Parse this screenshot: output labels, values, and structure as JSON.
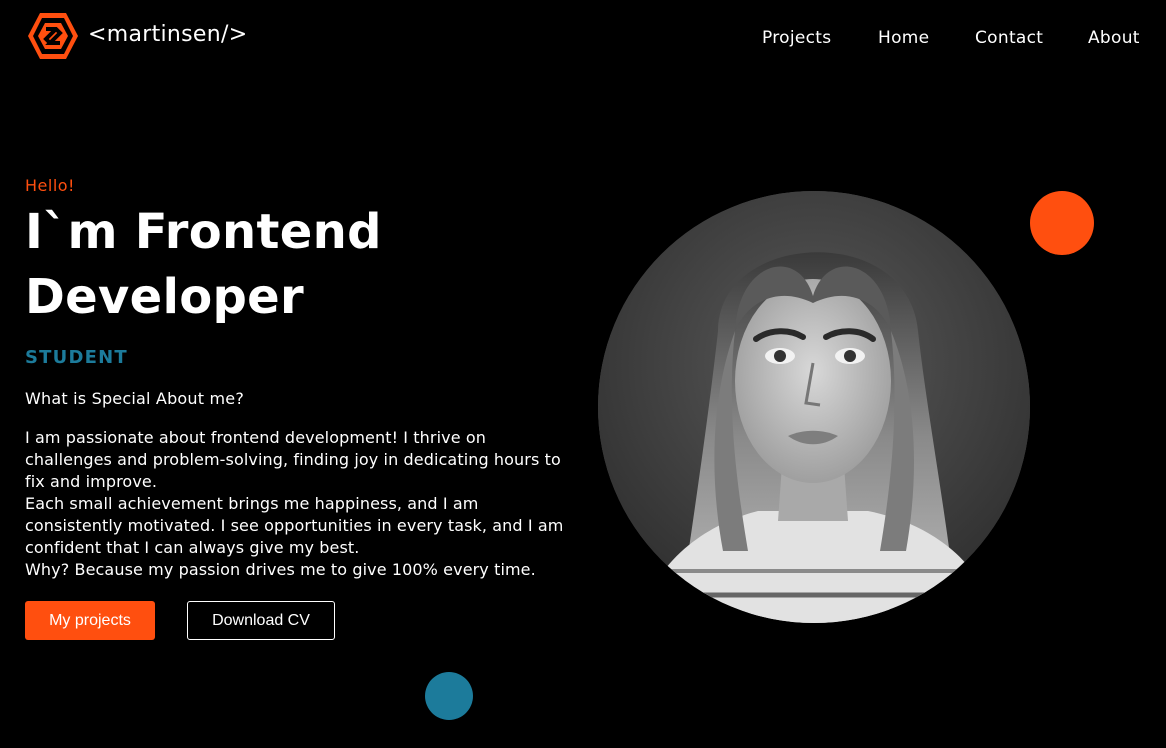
{
  "brand": {
    "logo_icon": "hexagon-s-logo-icon",
    "name": "<martinsen/>"
  },
  "nav": {
    "items": [
      {
        "label": "Projects"
      },
      {
        "label": "Home"
      },
      {
        "label": "Contact"
      },
      {
        "label": "About"
      }
    ]
  },
  "hero": {
    "greeting": "Hello!",
    "title_line1": "I`m Frontend",
    "title_line2": "Developer",
    "role": "STUDENT",
    "question": "What is Special About me?",
    "bio": [
      "I am passionate about frontend development! I thrive on challenges and problem-solving, finding joy in dedicating hours to fix and improve.",
      "Each small achievement brings me happiness, and I am consistently motivated. I see opportunities in every task, and I am confident that I can always give my best.",
      "Why? Because my passion drives me to give 100% every time."
    ],
    "primary_button": "My projects",
    "secondary_button": "Download CV"
  },
  "colors": {
    "accent": "#ff4f0f",
    "secondary": "#1c7b9b",
    "background": "#000000",
    "text": "#ffffff"
  }
}
